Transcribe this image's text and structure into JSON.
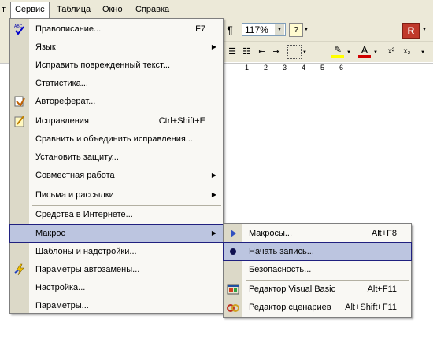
{
  "menubar": {
    "items": [
      {
        "label": "т"
      },
      {
        "label": "Сервис"
      },
      {
        "label": "Таблица"
      },
      {
        "label": "Окно"
      },
      {
        "label": "Справка"
      }
    ]
  },
  "toolbar": {
    "paragraph_mark": "¶",
    "zoom_value": "117%",
    "superscript": "x²",
    "subscript": "x₂",
    "font_color_letter": "A"
  },
  "ruler": {
    "marks": [
      "1",
      "2",
      "3",
      "4",
      "5",
      "6"
    ]
  },
  "service_menu": {
    "items": [
      {
        "label": "Правописание...",
        "shortcut": "F7",
        "icon": "spellcheck-icon"
      },
      {
        "label": "Язык",
        "submenu": true
      },
      {
        "label": "Исправить поврежденный текст..."
      },
      {
        "label": "Статистика..."
      },
      {
        "label": "Автореферат...",
        "icon": "autosummary-icon"
      },
      {
        "label": "Исправления",
        "shortcut": "Ctrl+Shift+E",
        "icon": "track-changes-icon"
      },
      {
        "label": "Сравнить и объединить исправления..."
      },
      {
        "label": "Установить защиту..."
      },
      {
        "label": "Совместная работа",
        "submenu": true
      },
      {
        "label": "Письма и рассылки",
        "submenu": true
      },
      {
        "label": "Средства в Интернете..."
      },
      {
        "label": "Макрос",
        "submenu": true,
        "highlighted": true
      },
      {
        "label": "Шаблоны и надстройки..."
      },
      {
        "label": "Параметры автозамены...",
        "icon": "autocorrect-icon"
      },
      {
        "label": "Настройка..."
      },
      {
        "label": "Параметры..."
      }
    ]
  },
  "macro_submenu": {
    "items": [
      {
        "label": "Макросы...",
        "shortcut": "Alt+F8",
        "icon": "play-icon"
      },
      {
        "label": "Начать запись...",
        "icon": "record-icon",
        "highlighted": true
      },
      {
        "label": "Безопасность..."
      },
      {
        "label": "Редактор Visual Basic",
        "shortcut": "Alt+F11",
        "icon": "vb-editor-icon"
      },
      {
        "label": "Редактор сценариев",
        "shortcut": "Alt+Shift+F11",
        "icon": "script-editor-icon"
      }
    ]
  },
  "colors": {
    "menu_bg": "#f9f8f4",
    "gutter": "#dcd9c8",
    "highlight": "#bcc5e0",
    "highlight_border": "#20207f",
    "bar": "#ece9d8"
  }
}
